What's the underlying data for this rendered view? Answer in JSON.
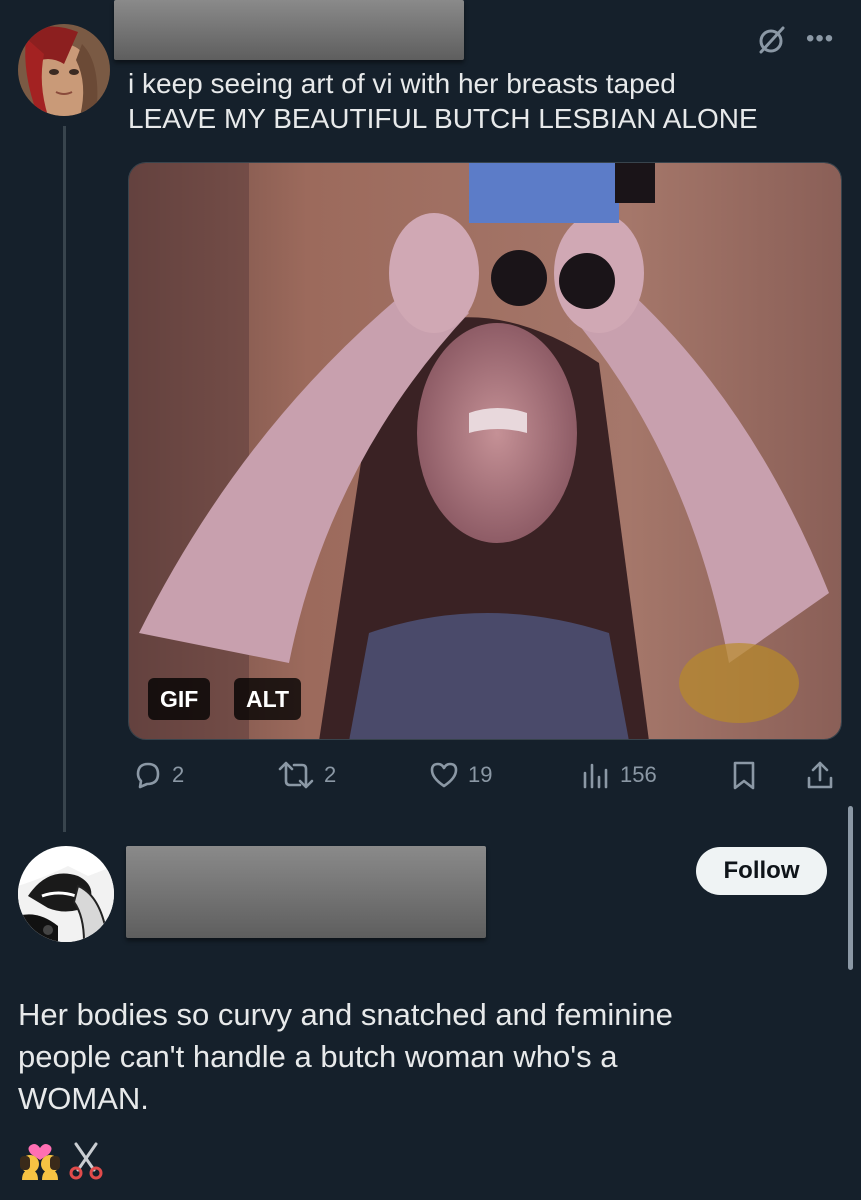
{
  "tweet": {
    "text_lines": [
      "i keep seeing art of vi with her breasts taped",
      "LEAVE MY BEAUTIFUL BUTCH LESBIAN ALONE"
    ],
    "media": {
      "badges": {
        "gif": "GIF",
        "alt": "ALT"
      }
    },
    "actions": {
      "replies": "2",
      "reposts": "2",
      "likes": "19",
      "views": "156"
    },
    "icons": [
      "grok-icon",
      "more-icon",
      "reply-icon",
      "repost-icon",
      "like-icon",
      "views-icon",
      "bookmark-icon",
      "share-icon"
    ]
  },
  "reply": {
    "follow_label": "Follow",
    "text_lines": [
      "Her bodies so curvy and snatched and feminine",
      "people can't handle a butch woman who's a",
      "WOMAN."
    ],
    "emoji": [
      "💏",
      "✂️"
    ]
  },
  "theme": {
    "background": "#15202b",
    "text": "#e7e9ea",
    "muted": "#8b98a5",
    "border": "#38444d"
  }
}
